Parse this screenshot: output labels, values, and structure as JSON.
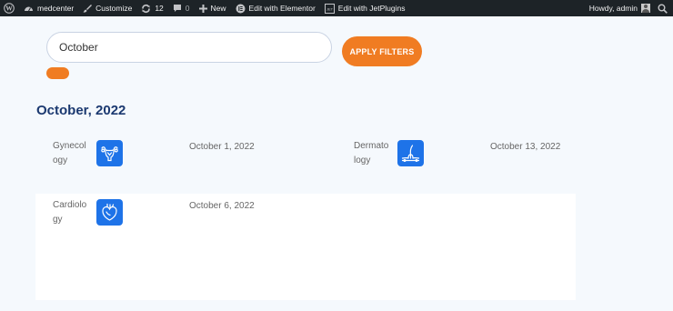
{
  "admin_bar": {
    "site_name": "medcenter",
    "customize": "Customize",
    "updates_count": "12",
    "comments_count": "0",
    "new_label": "New",
    "elementor_label": "Edit with Elementor",
    "jetplugins_label": "Edit with JetPlugins",
    "greeting": "Howdy, admin"
  },
  "filters": {
    "search_value": "October",
    "apply_label": "APPLY FILTERS"
  },
  "month_heading": "October, 2022",
  "events": [
    {
      "specialty": "Gynecology",
      "icon": "uterus-icon",
      "date": "October 1, 2022"
    },
    {
      "specialty": "Dermatology",
      "icon": "skin-hair-icon",
      "date": "October 13, 2022"
    },
    {
      "specialty": "Cardiology",
      "icon": "heart-icon",
      "date": "October 6, 2022"
    }
  ],
  "colors": {
    "accent": "#f07c22",
    "icon_bg": "#1e73e8",
    "heading": "#1b3970",
    "admin_bar": "#1d2327"
  }
}
